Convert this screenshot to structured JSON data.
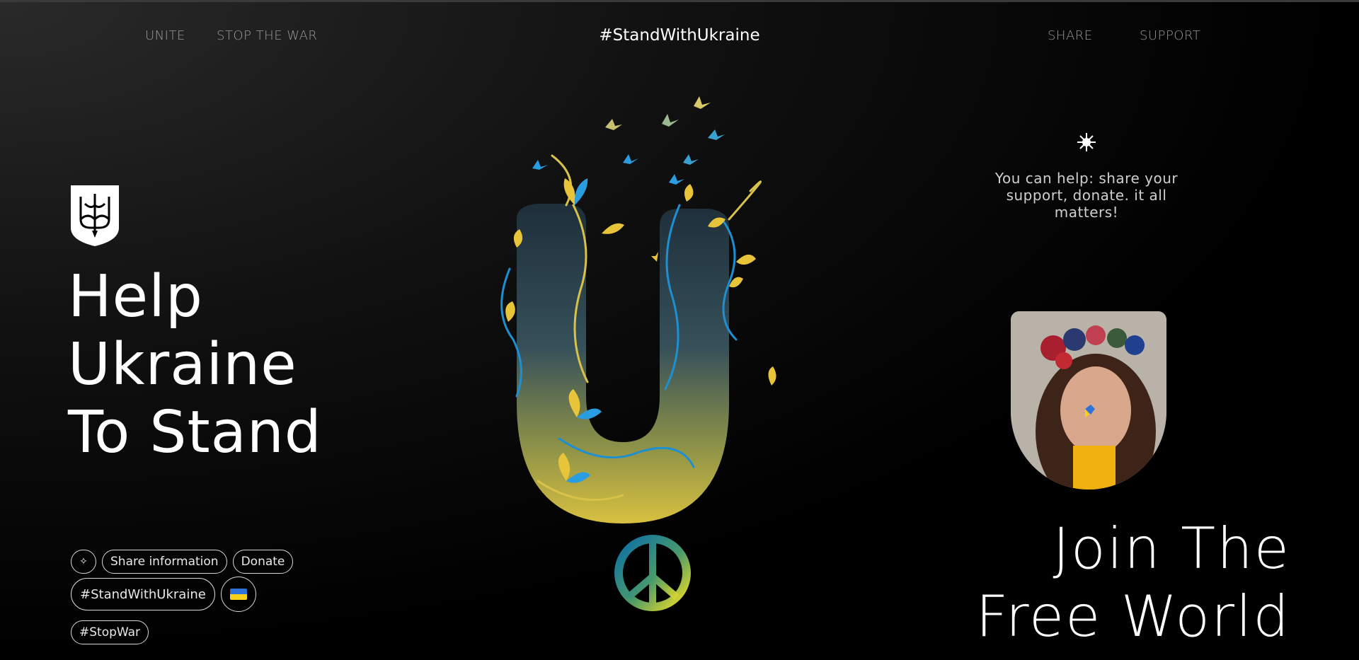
{
  "nav": {
    "unite": "UNITE",
    "stop_the_war": "STOP THE WAR",
    "hashtag": "#StandWithUkraine",
    "share": "SHARE",
    "support": "SUPPORT"
  },
  "hero": {
    "line1": "Help",
    "line2": "Ukraine",
    "line3": "To Stand"
  },
  "chips": {
    "row1": [
      "Share information",
      "Donate"
    ],
    "row2": [
      "#StandWithUkraine"
    ],
    "row3": [
      "#StopWar"
    ]
  },
  "right": {
    "help_text": "You can help: share your support, donate. it all matters!",
    "join_line1": "Join The",
    "join_line2": "Free World"
  },
  "icons": {
    "emblem": "trident-emblem-icon",
    "sparkle": "sparkle-icon",
    "chip_icon": "sparkle-star-icon",
    "flag": "ukraine-flag-icon",
    "peace": "peace-sign-icon"
  },
  "colors": {
    "ukraine_blue": "#1e90d8",
    "ukraine_yellow": "#f7d21a",
    "background": "#000000",
    "nav_text": "#9a9a9a"
  }
}
